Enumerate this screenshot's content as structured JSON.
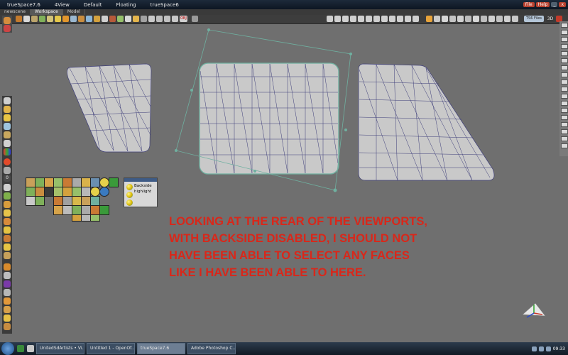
{
  "titlebar": {
    "app_title": "trueSpace7.6",
    "menus": [
      "4View",
      "Default",
      "Floating",
      "trueSpace6"
    ],
    "right_buttons": [
      "File",
      "Help"
    ]
  },
  "tabs": [
    "newscene",
    "Workspace",
    "Model"
  ],
  "toolbar": {
    "obj_label": "OBJ",
    "ts_files_label": "TS6 Files",
    "view_label": "3D"
  },
  "left_toolbar": {
    "number_label": "0"
  },
  "material_panel": {
    "items": [
      "Backside",
      "highlight"
    ]
  },
  "caption_lines": [
    "LOOKING AT THE REAR OF THE VIEWPORTS,",
    "WITH BACKSIDE DISABLED, I SHOULD NOT",
    "HAVE BEEN ABLE TO SELECT ANY FACES",
    "LIKE I HAVE BEEN ABLE TO HERE."
  ],
  "taskbar": {
    "tasks": [
      "UnitedSdArtists • Vi...",
      "Untitled 1 - OpenOf...",
      "trueSpace7.6",
      "Adobe Photoshop C..."
    ],
    "time": "09:33"
  },
  "colors": {
    "background": "#6f6f6f",
    "mesh_fill": "#c9c9c9",
    "mesh_edges": "#3e3e7a",
    "selection": "#6fb0a0",
    "caption": "#d9271a"
  },
  "icons": [
    "gizmo-axis-icon",
    "start-orb-icon",
    "material-ball-icon"
  ]
}
